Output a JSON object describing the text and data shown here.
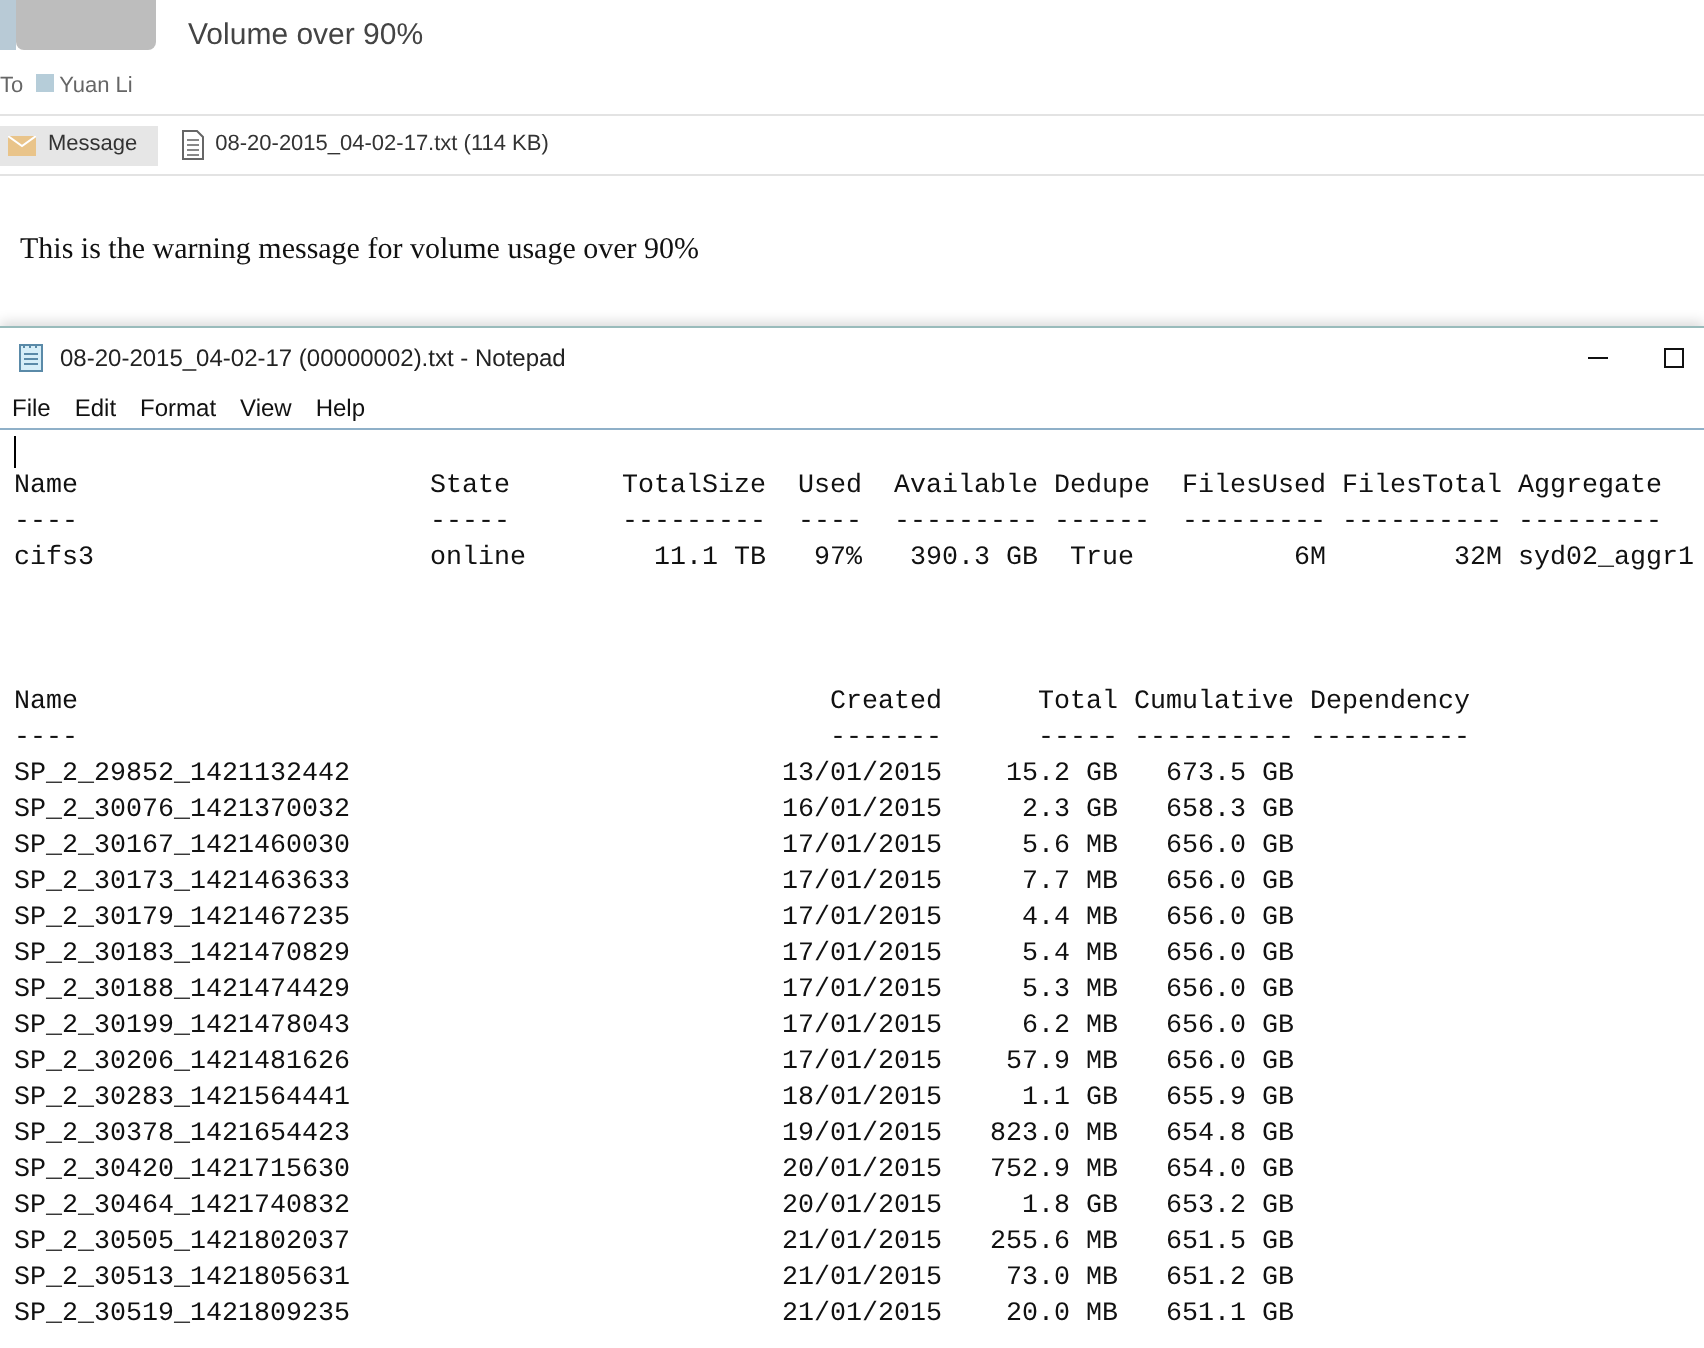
{
  "email": {
    "subject": "Volume over 90%",
    "to_label": "To",
    "recipients": [
      "Yuan Li"
    ],
    "tabs": [
      {
        "kind": "message",
        "label": "Message",
        "selected": true
      },
      {
        "kind": "attachment",
        "label": "08-20-2015_04-02-17.txt (114 KB)",
        "selected": false
      }
    ],
    "body": "This is the warning message for volume usage over 90%"
  },
  "notepad": {
    "title": "08-20-2015_04-02-17 (00000002).txt - Notepad",
    "menu": [
      "File",
      "Edit",
      "Format",
      "View",
      "Help"
    ],
    "volumes": {
      "columns": [
        "Name",
        "State",
        "TotalSize",
        "Used",
        "Available",
        "Dedupe",
        "FilesUsed",
        "FilesTotal",
        "Aggregate"
      ],
      "underlines": [
        "----",
        "-----",
        "---------",
        "----",
        "---------",
        "------",
        "---------",
        "----------",
        "---------"
      ],
      "rows": [
        [
          "cifs3",
          "online",
          "11.1 TB",
          "97%",
          "390.3 GB",
          "True",
          "6M",
          "32M",
          "syd02_aggr1"
        ]
      ]
    },
    "snapshots": {
      "columns": [
        "Name",
        "Created",
        "Total",
        "Cumulative",
        "Dependency"
      ],
      "underlines": [
        "----",
        "-------",
        "-----",
        "----------",
        "----------"
      ],
      "rows": [
        [
          "SP_2_29852_1421132442",
          "13/01/2015",
          "15.2 GB",
          "673.5 GB"
        ],
        [
          "SP_2_30076_1421370032",
          "16/01/2015",
          "2.3 GB",
          "658.3 GB"
        ],
        [
          "SP_2_30167_1421460030",
          "17/01/2015",
          "5.6 MB",
          "656.0 GB"
        ],
        [
          "SP_2_30173_1421463633",
          "17/01/2015",
          "7.7 MB",
          "656.0 GB"
        ],
        [
          "SP_2_30179_1421467235",
          "17/01/2015",
          "4.4 MB",
          "656.0 GB"
        ],
        [
          "SP_2_30183_1421470829",
          "17/01/2015",
          "5.4 MB",
          "656.0 GB"
        ],
        [
          "SP_2_30188_1421474429",
          "17/01/2015",
          "5.3 MB",
          "656.0 GB"
        ],
        [
          "SP_2_30199_1421478043",
          "17/01/2015",
          "6.2 MB",
          "656.0 GB"
        ],
        [
          "SP_2_30206_1421481626",
          "17/01/2015",
          "57.9 MB",
          "656.0 GB"
        ],
        [
          "SP_2_30283_1421564441",
          "18/01/2015",
          "1.1 GB",
          "655.9 GB"
        ],
        [
          "SP_2_30378_1421654423",
          "19/01/2015",
          "823.0 MB",
          "654.8 GB"
        ],
        [
          "SP_2_30420_1421715630",
          "20/01/2015",
          "752.9 MB",
          "654.0 GB"
        ],
        [
          "SP_2_30464_1421740832",
          "20/01/2015",
          "1.8 GB",
          "653.2 GB"
        ],
        [
          "SP_2_30505_1421802037",
          "21/01/2015",
          "255.6 MB",
          "651.5 GB"
        ],
        [
          "SP_2_30513_1421805631",
          "21/01/2015",
          "73.0 MB",
          "651.2 GB"
        ],
        [
          "SP_2_30519_1421809235",
          "21/01/2015",
          "20.0 MB",
          "651.1 GB"
        ]
      ]
    }
  }
}
